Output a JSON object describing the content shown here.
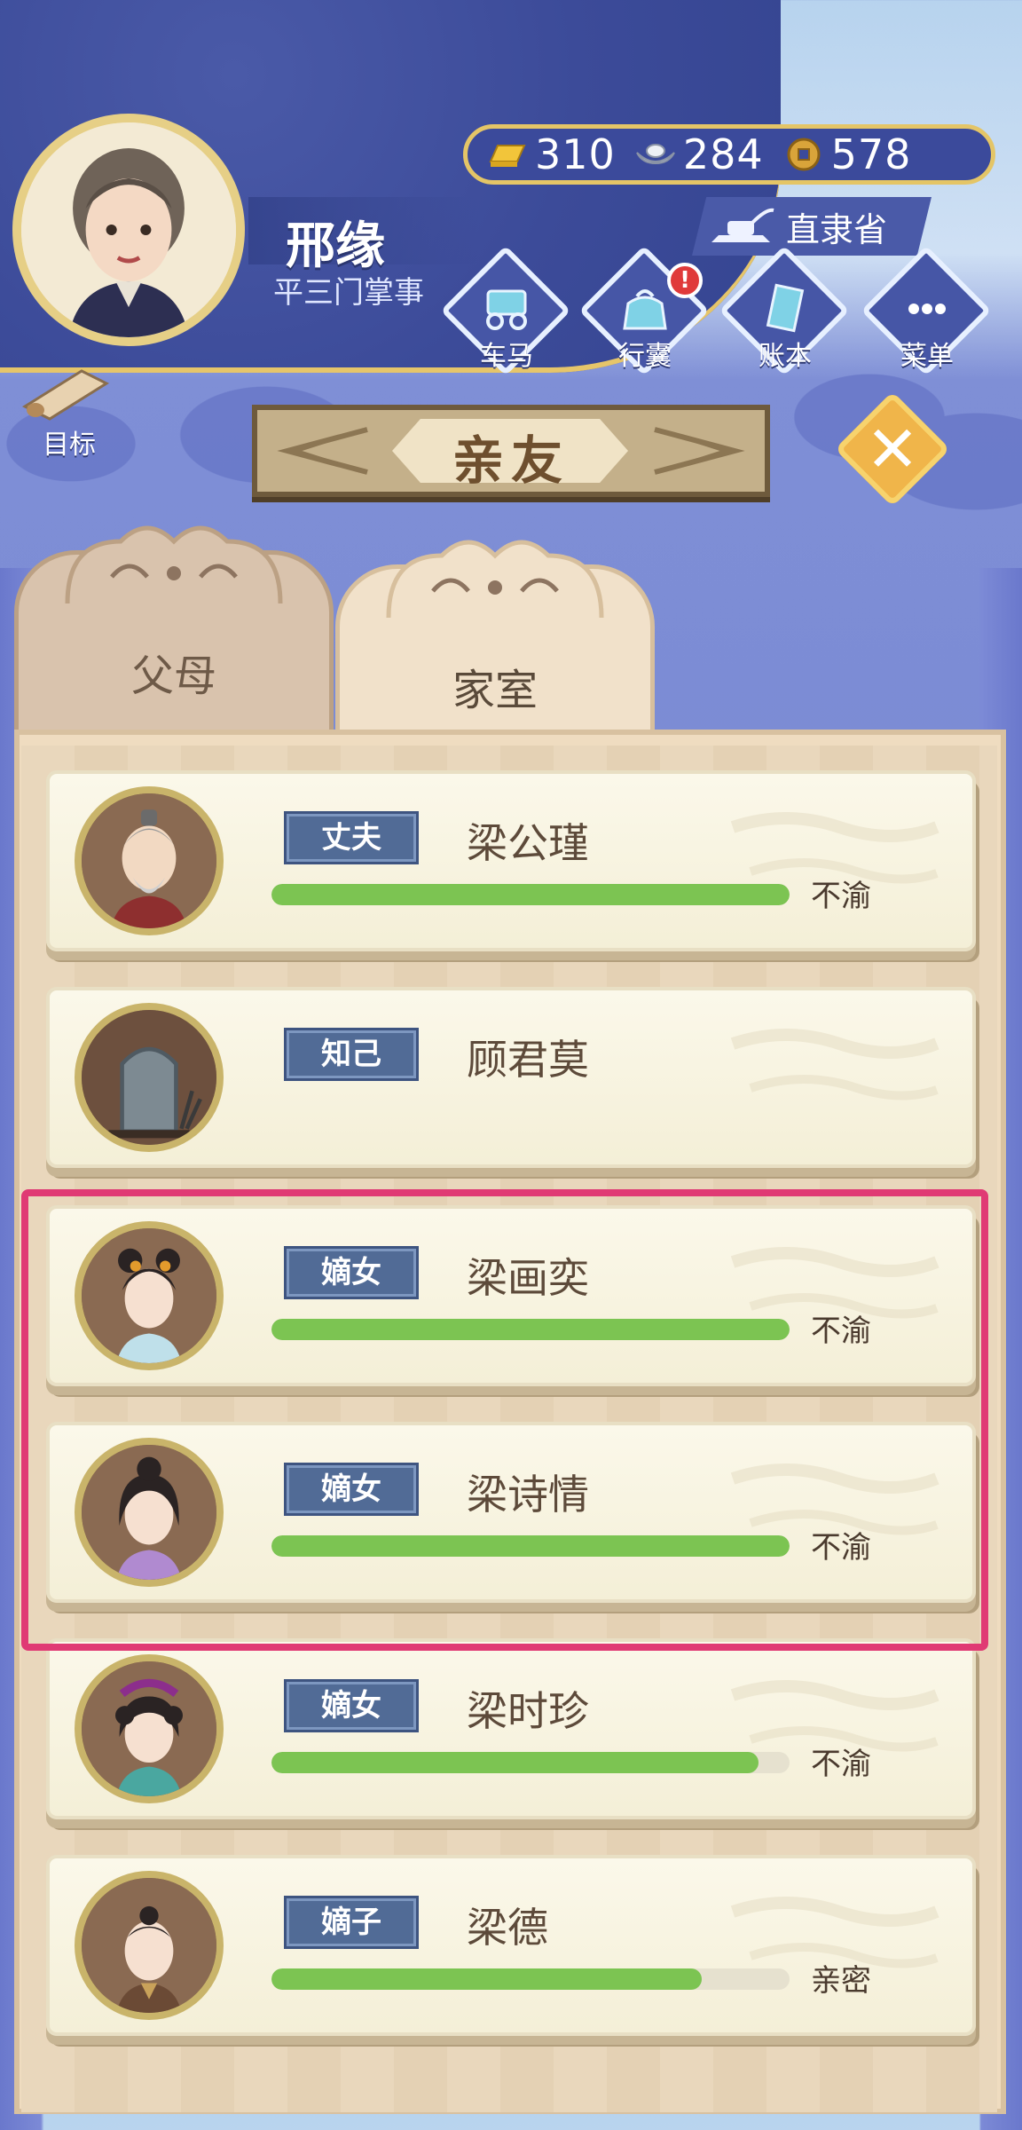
{
  "player": {
    "name": "邢缘",
    "title": "平三门掌事"
  },
  "currency": [
    {
      "icon": "gold-ingot-icon",
      "value": "310"
    },
    {
      "icon": "silver-ingot-icon",
      "value": "284"
    },
    {
      "icon": "copper-coin-icon",
      "value": "578"
    }
  ],
  "province": {
    "label": "直隶省"
  },
  "menu": [
    {
      "label": "车马",
      "icon": "carriage-icon"
    },
    {
      "label": "行囊",
      "icon": "bag-icon",
      "alert": "!"
    },
    {
      "label": "账本",
      "icon": "ledger-icon"
    },
    {
      "label": "菜单",
      "icon": "more-icon"
    }
  ],
  "goal": {
    "label": "目标"
  },
  "panel": {
    "title": "亲友"
  },
  "tabs": [
    {
      "label": "父母",
      "active": false
    },
    {
      "label": "家室",
      "active": true
    }
  ],
  "relatives": [
    {
      "relation": "丈夫",
      "name": "梁公瑾",
      "status": "不渝",
      "affinity": 1.0,
      "portrait": "elder-man"
    },
    {
      "relation": "知己",
      "name": "顾君莫",
      "status": "",
      "affinity": null,
      "portrait": "tombstone"
    },
    {
      "relation": "嫡女",
      "name": "梁画奕",
      "status": "不渝",
      "affinity": 1.0,
      "portrait": "girl-ornate"
    },
    {
      "relation": "嫡女",
      "name": "梁诗情",
      "status": "不渝",
      "affinity": 1.0,
      "portrait": "girl-lilac"
    },
    {
      "relation": "嫡女",
      "name": "梁时珍",
      "status": "不渝",
      "affinity": 0.94,
      "portrait": "girl-teal"
    },
    {
      "relation": "嫡子",
      "name": "梁德",
      "status": "亲密",
      "affinity": 0.83,
      "portrait": "boy"
    }
  ],
  "colors": {
    "affinity_bar": "#7cc452",
    "highlight": "#e03a74",
    "banner": "#3c4b99"
  }
}
